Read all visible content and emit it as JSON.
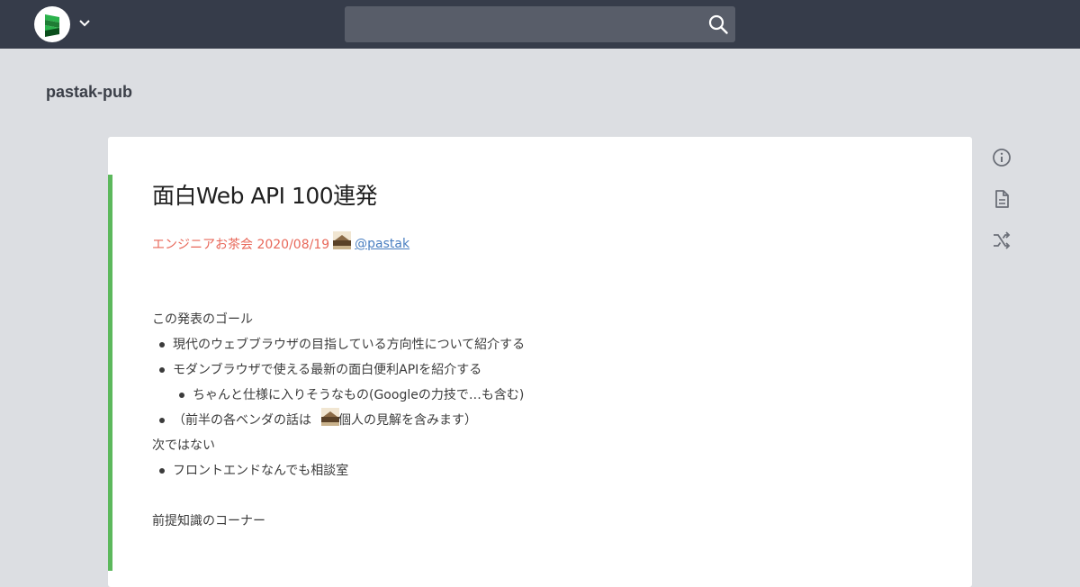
{
  "header": {
    "logo_icon": "scrapbox-logo-icon",
    "menu_icon": "chevron-down-icon",
    "search": {
      "placeholder": "",
      "value": "",
      "icon": "search-icon"
    }
  },
  "project": {
    "name": "pastak-pub"
  },
  "page": {
    "title": "面白Web API 100連発",
    "meta": {
      "event_date": "エンジニアお茶会 2020/08/19",
      "user_link": "@pastak"
    },
    "lines": [
      {
        "text": "この発表のゴール",
        "indent": 0
      },
      {
        "text": "現代のウェブブラウザの目指している方向性について紹介する",
        "indent": 1
      },
      {
        "text": "モダンブラウザで使える最新の面白便利APIを紹介する",
        "indent": 1
      },
      {
        "text": "ちゃんと仕様に入りそうなもの(Googleの力技で…も含む)",
        "indent": 2
      },
      {
        "text_before": "（前半の各ベンダの話は",
        "text_after": "個人の見解を含みます）",
        "indent": 1
      },
      {
        "text": "次ではない",
        "indent": 0
      },
      {
        "text": "フロントエンドなんでも相談室",
        "indent": 1
      },
      {
        "text": "前提知識のコーナー",
        "indent": 0
      }
    ]
  },
  "side_actions": [
    {
      "icon": "info-icon"
    },
    {
      "icon": "document-icon"
    },
    {
      "icon": "shuffle-icon"
    }
  ],
  "colors": {
    "topbar": "#363c4a",
    "background": "#dcdee2",
    "accent_bar": "#5cb85c",
    "meta_text": "#e8685a",
    "link": "#4a7fc1"
  }
}
